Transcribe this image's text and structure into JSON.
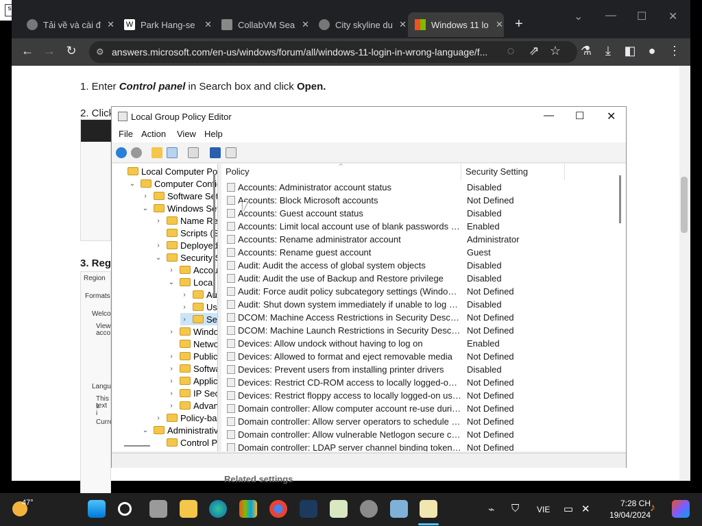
{
  "browser": {
    "tabs": [
      {
        "title": "Tải về và cài đ",
        "active": false
      },
      {
        "title": "Park Hang-se",
        "active": false
      },
      {
        "title": "CollabVM Sea",
        "active": false
      },
      {
        "title": "City skyline du",
        "active": false
      },
      {
        "title": "Windows 11 lo",
        "active": true
      }
    ],
    "url": "answers.microsoft.com/en-us/windows/forum/all/windows-11-login-in-wrong-language/f..."
  },
  "page": {
    "step1_prefix": "1. Enter ",
    "step1_bold": "Control panel",
    "step1_mid": " in Search box and click ",
    "step1_open": "Open.",
    "step2": "2. Click",
    "step3": "3. Regi",
    "region": "Region",
    "formats": "Formats",
    "welcome": "Welco",
    "view": "View",
    "acco": "acco",
    "langu": "Langu",
    "this_s": "This s",
    "text_i": "text i",
    "curre": "Curre",
    "related": "Related settings"
  },
  "gpedit": {
    "title": "Local Group Policy Editor",
    "menu": [
      "File",
      "Action",
      "View",
      "Help"
    ],
    "tree": [
      {
        "label": "Local Computer Polic",
        "indent": 0,
        "arrow": ""
      },
      {
        "label": "Computer Config",
        "indent": 1,
        "arrow": "v"
      },
      {
        "label": "Software Setti",
        "indent": 2,
        "arrow": ">"
      },
      {
        "label": "Windows Sett",
        "indent": 2,
        "arrow": "v"
      },
      {
        "label": "Name Res",
        "indent": 3,
        "arrow": ">"
      },
      {
        "label": "Scripts (Sta",
        "indent": 3,
        "arrow": ""
      },
      {
        "label": "Deployed",
        "indent": 3,
        "arrow": ">"
      },
      {
        "label": "Security Se",
        "indent": 3,
        "arrow": "v"
      },
      {
        "label": "Accou",
        "indent": 4,
        "arrow": ">"
      },
      {
        "label": "Local P",
        "indent": 4,
        "arrow": "v"
      },
      {
        "label": "Au",
        "indent": 5,
        "arrow": ">"
      },
      {
        "label": "Use",
        "indent": 5,
        "arrow": ">"
      },
      {
        "label": "Sec",
        "indent": 5,
        "arrow": ">",
        "selected": true
      },
      {
        "label": "Windo",
        "indent": 4,
        "arrow": ">"
      },
      {
        "label": "Netwo",
        "indent": 4,
        "arrow": ""
      },
      {
        "label": "Public",
        "indent": 4,
        "arrow": ">"
      },
      {
        "label": "Softwa",
        "indent": 4,
        "arrow": ">"
      },
      {
        "label": "Applic",
        "indent": 4,
        "arrow": ">"
      },
      {
        "label": "IP Secu",
        "indent": 4,
        "arrow": ">"
      },
      {
        "label": "Advan",
        "indent": 4,
        "arrow": ">"
      },
      {
        "label": "Policy-bas",
        "indent": 3,
        "arrow": ">"
      },
      {
        "label": "Administrative",
        "indent": 2,
        "arrow": "v"
      },
      {
        "label": "Control P",
        "indent": 3,
        "arrow": ""
      }
    ],
    "columns": {
      "policy": "Policy",
      "setting": "Security Setting"
    },
    "rows": [
      {
        "policy": "Accounts: Administrator account status",
        "setting": "Disabled"
      },
      {
        "policy": "Accounts: Block Microsoft accounts",
        "setting": "Not Defined"
      },
      {
        "policy": "Accounts: Guest account status",
        "setting": "Disabled"
      },
      {
        "policy": "Accounts: Limit local account use of blank passwords to co...",
        "setting": "Enabled"
      },
      {
        "policy": "Accounts: Rename administrator account",
        "setting": "Administrator"
      },
      {
        "policy": "Accounts: Rename guest account",
        "setting": "Guest"
      },
      {
        "policy": "Audit: Audit the access of global system objects",
        "setting": "Disabled"
      },
      {
        "policy": "Audit: Audit the use of Backup and Restore privilege",
        "setting": "Disabled"
      },
      {
        "policy": "Audit: Force audit policy subcategory settings (Windows Vis...",
        "setting": "Not Defined"
      },
      {
        "policy": "Audit: Shut down system immediately if unable to log secur...",
        "setting": "Disabled"
      },
      {
        "policy": "DCOM: Machine Access Restrictions in Security Descriptor D...",
        "setting": "Not Defined"
      },
      {
        "policy": "DCOM: Machine Launch Restrictions in Security Descriptor ...",
        "setting": "Not Defined"
      },
      {
        "policy": "Devices: Allow undock without having to log on",
        "setting": "Enabled"
      },
      {
        "policy": "Devices: Allowed to format and eject removable media",
        "setting": "Not Defined"
      },
      {
        "policy": "Devices: Prevent users from installing printer drivers",
        "setting": "Disabled"
      },
      {
        "policy": "Devices: Restrict CD-ROM access to locally logged-on user ...",
        "setting": "Not Defined"
      },
      {
        "policy": "Devices: Restrict floppy access to locally logged-on user only",
        "setting": "Not Defined"
      },
      {
        "policy": "Domain controller: Allow computer account re-use during d...",
        "setting": "Not Defined"
      },
      {
        "policy": "Domain controller: Allow server operators to schedule tasks",
        "setting": "Not Defined"
      },
      {
        "policy": "Domain controller: Allow vulnerable Netlogon secure chann...",
        "setting": "Not Defined"
      },
      {
        "policy": "Domain controller: LDAP server channel binding token requi...",
        "setting": "Not Defined"
      }
    ]
  },
  "taskbar": {
    "weather": "47°",
    "lang": "VIE",
    "time": "7:28 CH",
    "date": "19/04/2024"
  },
  "colors": {
    "accent": "#0078d4",
    "chrome_dark": "#202124",
    "folder": "#f4c64a"
  }
}
